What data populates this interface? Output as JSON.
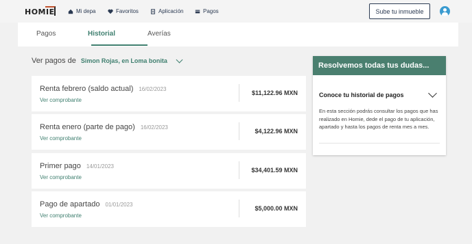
{
  "nav": {
    "logo": "HOMIE",
    "links": [
      {
        "label": "Mi depa",
        "icon": "home-icon"
      },
      {
        "label": "Favoritos",
        "icon": "heart-icon"
      },
      {
        "label": "Aplicación",
        "icon": "document-icon"
      },
      {
        "label": "Pagos",
        "icon": "card-icon"
      }
    ],
    "upload_button": "Sube tu inmueble",
    "avatar_icon": "user-icon"
  },
  "tabs": [
    {
      "label": "Pagos",
      "active": false
    },
    {
      "label": "Historial",
      "active": true
    },
    {
      "label": "Averías",
      "active": false
    }
  ],
  "filter": {
    "label": "Ver pagos de",
    "selected": "Simon Rojas, en Loma bonita"
  },
  "payments": [
    {
      "title": "Renta febrero (saldo actual)",
      "date": "16/02/2023",
      "link": "Ver comprobante",
      "amount": "$11,122.96 MXN"
    },
    {
      "title": "Renta enero (parte de pago)",
      "date": "16/02/2023",
      "link": "Ver comprobante",
      "amount": "$4,122.96 MXN"
    },
    {
      "title": "Primer pago",
      "date": "14/01/2023",
      "link": "Ver comprobante",
      "amount": "$34,401.59 MXN"
    },
    {
      "title": "Pago de apartado",
      "date": "01/01/2023",
      "link": "Ver comprobante",
      "amount": "$5,000.00 MXN"
    }
  ],
  "faq": {
    "header": "Resolvemos todas tus dudas...",
    "question": "Conoce tu historial de pagos",
    "answer": "En esta sección podrás consultar los pagos que has realizado en Homie, dede el pago de tu aplicación, apartado y hasta los pagos de renta mes a mes."
  },
  "colors": {
    "accent": "#3f7f6f",
    "faq_header": "#4a7f6f",
    "logo_accent": "#c0502b",
    "nav_text": "#2b3a52"
  }
}
